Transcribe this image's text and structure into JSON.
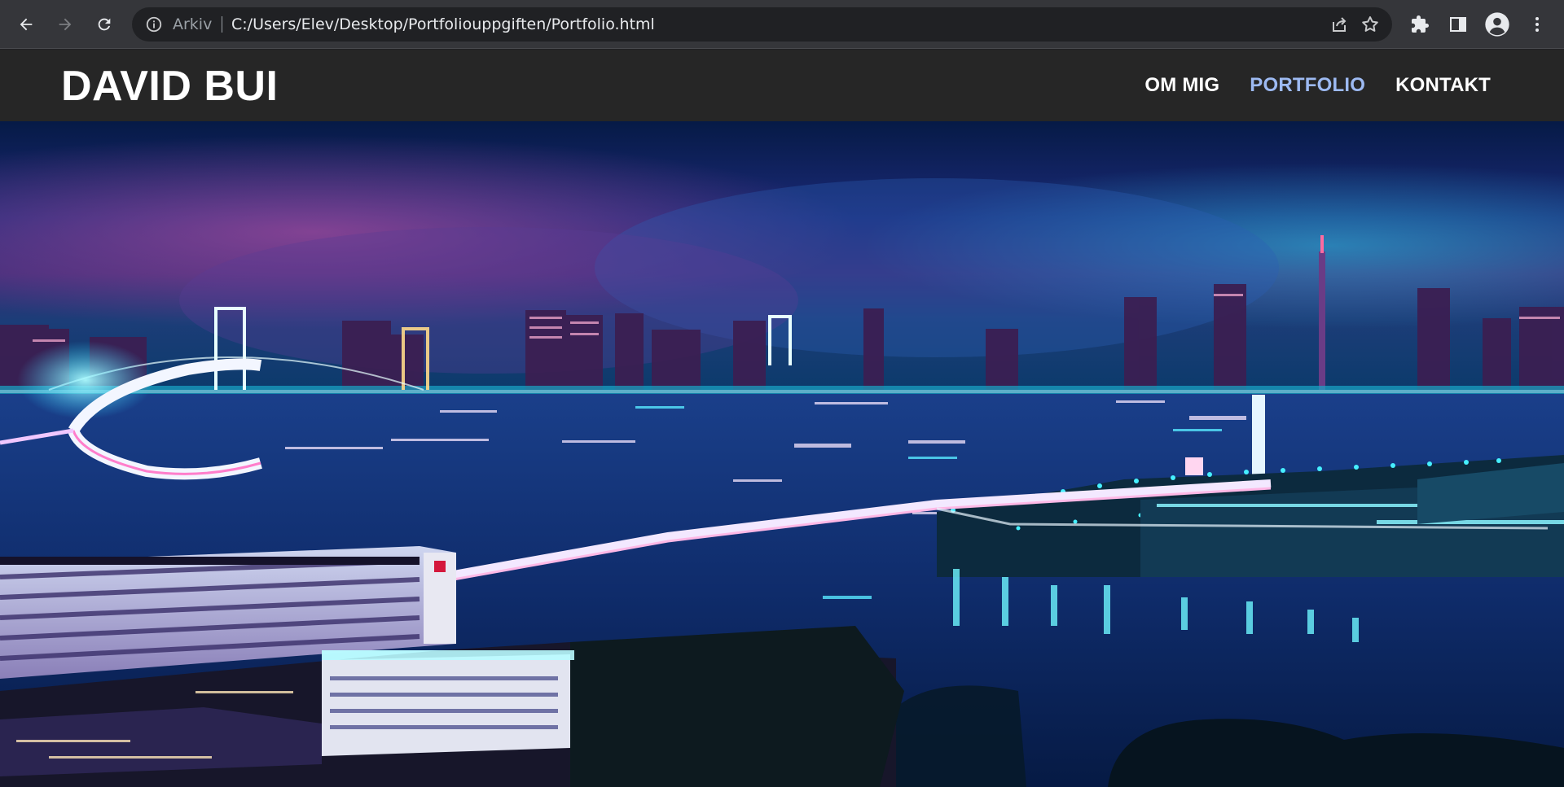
{
  "browser": {
    "nav": {
      "back_icon": "arrow-left-icon",
      "forward_icon": "arrow-right-icon",
      "reload_icon": "reload-icon"
    },
    "omnibox": {
      "scheme_label": "Arkiv",
      "url": "C:/Users/Elev/Desktop/Portfoliouppgiften/Portfolio.html",
      "info_icon": "info-icon",
      "share_icon": "share-icon",
      "bookmark_icon": "star-icon"
    },
    "toolbar": {
      "extensions_icon": "puzzle-icon",
      "side_panel_icon": "side-panel-icon",
      "profile_icon": "avatar-icon",
      "menu_icon": "kebab-menu-icon"
    }
  },
  "site": {
    "logo": "DAVID BUI",
    "nav": [
      {
        "label": "OM MIG",
        "active": false
      },
      {
        "label": "PORTFOLIO",
        "active": true
      },
      {
        "label": "KONTAKT",
        "active": false
      }
    ],
    "colors": {
      "header_bg": "#262626",
      "nav_text": "#ffffff",
      "nav_active": "#9dbaf2"
    },
    "hero": {
      "subject": "night-city-harbor-photo"
    }
  }
}
